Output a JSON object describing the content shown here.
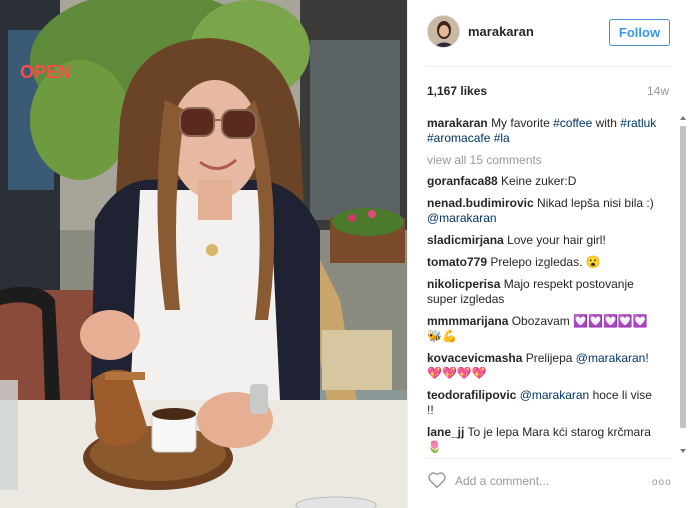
{
  "post": {
    "username": "marakaran",
    "follow_label": "Follow",
    "likes": "1,167 likes",
    "age": "14w",
    "caption": {
      "user": "marakaran",
      "text_before": "My favorite",
      "tag1": "#coffee",
      "text_mid": "with",
      "tag2": "#ratluk",
      "tag3": "#aromacafe",
      "tag4": "#la"
    },
    "view_all": "view all 15 comments",
    "add_comment_placeholder": "Add a comment...",
    "more_label": "ooo"
  },
  "photo": {
    "sign_text": "OPEN"
  },
  "comments": [
    {
      "user": "goranfaca88",
      "text": "Keine zuker:D",
      "mention": ""
    },
    {
      "user": "nenad.budimirovic",
      "text": "Nikad lepša nisi bila :)",
      "mention": "@marakaran"
    },
    {
      "user": "sladicmirjana",
      "text": "Love your hair girl!",
      "mention": ""
    },
    {
      "user": "tomato779",
      "text": "Prelepo izgledas. 😮",
      "mention": ""
    },
    {
      "user": "nikolicperisa",
      "text": "Majo respekt postovanje super izgledas",
      "mention": ""
    },
    {
      "user": "mmmmarijana",
      "text": "Obozavam 💟💟💟💟💟🐝💪",
      "mention": ""
    },
    {
      "user": "kovacevicmasha",
      "text": "Prelijepa",
      "mention": "@marakaran!",
      "after": "💖💖💖💖"
    },
    {
      "user": "teodorafilipovic",
      "text": "",
      "mention": "@marakaran",
      "after": "hoce li vise !!"
    },
    {
      "user": "lane_jj",
      "text": "To je lepa Mara kći starog krčmara 🌷",
      "mention": ""
    }
  ],
  "colors": {
    "accent": "#3897f0",
    "tag": "#003569",
    "muted": "#999999"
  },
  "icons": [
    "heart-icon",
    "more-options-icon"
  ]
}
